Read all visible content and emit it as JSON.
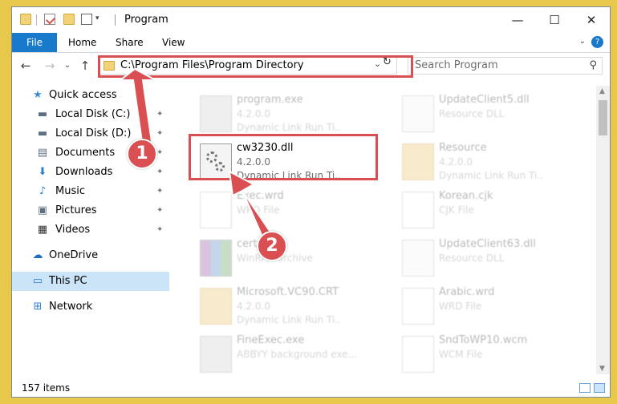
{
  "window": {
    "title": "Program",
    "minimize_glyph": "—",
    "maximize_glyph": "☐",
    "close_glyph": "✕"
  },
  "ribbon": {
    "tabs": [
      {
        "label": "File"
      },
      {
        "label": "Home"
      },
      {
        "label": "Share"
      },
      {
        "label": "View"
      }
    ],
    "help_glyph": "?",
    "collapse_glyph": "⌄"
  },
  "address_bar": {
    "path": "C:\\Program Files\\Program Directory",
    "dropdown_glyph": "⌄",
    "refresh_glyph": "↻",
    "back_glyph": "←",
    "forward_glyph": "→",
    "recent_glyph": "⌄",
    "up_glyph": "↑"
  },
  "search": {
    "placeholder": "Search Program",
    "icon_glyph": "⚲"
  },
  "nav_pane": {
    "items": [
      {
        "label": "Quick access",
        "icon": "star-icon",
        "glyph": "★",
        "color": "#3a8fd8"
      },
      {
        "label": "Local Disk (C:)",
        "icon": "drive-icon",
        "glyph": "▬",
        "color": "#5d6f82"
      },
      {
        "label": "Local Disk (D:)",
        "icon": "drive-icon",
        "glyph": "▬",
        "color": "#5d6f82"
      },
      {
        "label": "Documents",
        "icon": "document-icon",
        "glyph": "▤",
        "color": "#5d6f82"
      },
      {
        "label": "Downloads",
        "icon": "download-arrow-icon",
        "glyph": "⬇",
        "color": "#2f7fd1"
      },
      {
        "label": "Music",
        "icon": "music-note-icon",
        "glyph": "♪",
        "color": "#2f7fd1"
      },
      {
        "label": "Pictures",
        "icon": "pictures-icon",
        "glyph": "▣",
        "color": "#5d6f82"
      },
      {
        "label": "Videos",
        "icon": "film-icon",
        "glyph": "▦",
        "color": "#333333"
      },
      {
        "label": "OneDrive",
        "icon": "cloud-icon",
        "glyph": "☁",
        "color": "#1f6fc1"
      },
      {
        "label": "This PC",
        "icon": "monitor-icon",
        "glyph": "▭",
        "color": "#2f7fd1"
      },
      {
        "label": "Network",
        "icon": "network-icon",
        "glyph": "⊞",
        "color": "#2f7fd1"
      }
    ],
    "pin_glyph": "📌"
  },
  "files": [
    {
      "name": "program.exe",
      "version": "4.2.0.0",
      "type": "Dynamic Link Run Ti...",
      "icon": "exe-icon",
      "state": "faded"
    },
    {
      "name": "UpdateClient5.dll",
      "version": "",
      "type": "Resource DLL",
      "icon": "dll-icon",
      "state": "faded"
    },
    {
      "name": "cw3230.dll",
      "version": "4.2.0.0",
      "type": "Dynamic Link Run Ti...",
      "icon": "dll-gear-icon",
      "state": "selected"
    },
    {
      "name": "Resource",
      "version": "4.2.0.0",
      "type": "Dynamic Link Run Ti...",
      "icon": "folder-icon",
      "state": "faded"
    },
    {
      "name": "Exec.wrd",
      "version": "",
      "type": "WRD File",
      "icon": "file-icon",
      "state": "faded"
    },
    {
      "name": "Korean.cjk",
      "version": "",
      "type": "CJK File",
      "icon": "file-icon",
      "state": "faded"
    },
    {
      "name": "cert.cab",
      "version": "",
      "type": "WinRAR archive",
      "icon": "winrar-icon",
      "state": "faded"
    },
    {
      "name": "UpdateClient63.dll",
      "version": "",
      "type": "Resource DLL",
      "icon": "dll-icon",
      "state": "faded"
    },
    {
      "name": "Microsoft.VC90.CRT",
      "version": "4.2.0.0",
      "type": "Dynamic Link Run Ti...",
      "icon": "folder-icon",
      "state": "faded"
    },
    {
      "name": "Arabic.wrd",
      "version": "",
      "type": "WRD File",
      "icon": "file-icon",
      "state": "faded"
    },
    {
      "name": "FineExec.exe",
      "version": "",
      "type": "ABBYY background exe...",
      "icon": "exe-icon",
      "state": "faded"
    },
    {
      "name": "SndToWP10.wcm",
      "version": "",
      "type": "WCM File",
      "icon": "file-icon",
      "state": "faded"
    }
  ],
  "status_bar": {
    "item_count": "157 items"
  },
  "callouts": [
    {
      "label": "1"
    },
    {
      "label": "2"
    }
  ],
  "colors": {
    "accent": "#1979ca",
    "highlight": "#d94f52",
    "selected_nav": "#cce4f7"
  }
}
